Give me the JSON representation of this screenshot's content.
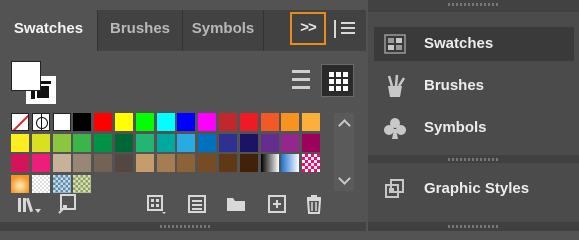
{
  "tabs": [
    {
      "label": "Swatches",
      "active": true
    },
    {
      "label": "Brushes",
      "active": false
    },
    {
      "label": "Symbols",
      "active": false
    }
  ],
  "collapse_label": ">>",
  "icons": {
    "collapse": "double-chevron-right-icon",
    "menu": "hamburger-menu-icon",
    "list_view": "list-view-icon",
    "grid_view": "grid-view-icon",
    "libraries": "libraries-icon",
    "place": "place-swatch-icon",
    "swatch_kind": "swatch-kind-menu-icon",
    "options": "swatch-options-icon",
    "new_group": "folder-icon",
    "new_swatch": "new-swatch-icon",
    "delete": "trash-icon"
  },
  "fill_color": "#ffffff",
  "stroke_color": "#000000",
  "swatch_rows": [
    [
      "none",
      "registration",
      "#ffffff",
      "#000000",
      "#ff0000",
      "#ffff00",
      "#00ff00",
      "#00ffff",
      "#0000ff",
      "#ff00ff",
      "#c1272d",
      "#ed1c24",
      "#f15a24",
      "#f7931e",
      "#fbb03b"
    ],
    [
      "#fcee21",
      "#d9e021",
      "#8cc63f",
      "#39b54a",
      "#009245",
      "#006837",
      "#22b573",
      "#00a99d",
      "#29abe2",
      "#0071bc",
      "#2e3192",
      "#1b1464",
      "#662d91",
      "#93278f",
      "#9e005d"
    ],
    [
      "#d4145a",
      "#ed1e79",
      "#c7b299",
      "#998675",
      "#736357",
      "#534741",
      "#c69c6d",
      "#a67c52",
      "#8c6239",
      "#754c24",
      "#603813",
      "#42210b",
      "gradient-black",
      "gradient-blue",
      "gradient-pink"
    ],
    [
      "gradient-orange",
      "pattern-dots",
      "pattern-blue",
      "pattern-green"
    ]
  ],
  "right_panel": [
    {
      "label": "Swatches",
      "icon": "swatches-icon",
      "active": true
    },
    {
      "label": "Brushes",
      "icon": "brushes-icon",
      "active": false
    },
    {
      "label": "Symbols",
      "icon": "club-icon",
      "active": false
    },
    {
      "label": "Graphic Styles",
      "icon": "graphic-styles-icon",
      "active": false
    }
  ]
}
